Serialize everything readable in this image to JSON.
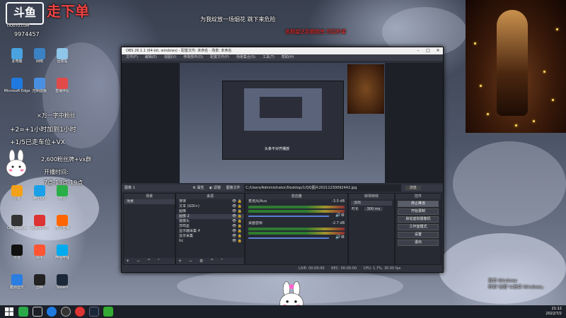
{
  "stream_overlay": {
    "logo_text": "斗鱼",
    "logo_subtext": "DOUYU.COM",
    "channel_title": "走下单",
    "room_number": "9974457",
    "song_line": "为我绽放一场烟花 跳下来危险",
    "comment_line": "逃期望达到拥抱完 然后秒架",
    "promo": {
      "line1": "×万一字中粉丝",
      "line2": "+2=+1小时加到1小时",
      "line3": "+1/5已走车位+VX",
      "line4": "2,600粉丝牌+vx群",
      "schedule_label": "开播时间:",
      "schedule_time": "7点-13点-19点"
    }
  },
  "obs": {
    "window_title": "OBS 26.1.1 (64-bit, windows) - 配置文件: 未命名 - 场景: 未命名",
    "menu": [
      "文件(F)",
      "编辑(E)",
      "视图(V)",
      "停靠部件(D)",
      "配置文件(P)",
      "场景集合(S)",
      "工具(T)",
      "帮助(H)"
    ],
    "context_bar": {
      "scene_label": "图像 1",
      "properties": "属性",
      "filters": "滤镜",
      "image_file_label": "图像文件",
      "image_path": "C:/Users/Administrator/Desktop/1/QQ图片20211230092442.jpg",
      "browse": "浏览"
    },
    "scenes": {
      "header": "场景",
      "items": [
        "场景"
      ]
    },
    "sources": {
      "header": "来源",
      "items": [
        "排排",
        "文本 (GDI+)",
        "图像",
        "图像 2",
        "摄像头",
        "苏鸣星",
        "显示器采集 4",
        "显示采集",
        "tic"
      ]
    },
    "mixer": {
      "header": "混音器",
      "channels": [
        {
          "name": "麦克风/Aux",
          "db": "-3.0 dB"
        },
        {
          "name": "桌面音频",
          "db": "-2.7 dB"
        }
      ]
    },
    "transitions": {
      "header": "转场特效",
      "type": "淡出",
      "duration_label": "时长",
      "duration": "300 ms"
    },
    "controls": {
      "header": "控件",
      "buttons": [
        "停止推流",
        "开始录制",
        "启动虚拟摄像机",
        "工作室模式",
        "设置",
        "退出"
      ]
    },
    "status": {
      "live": "LIVE: 00:00:00",
      "rec": "REC: 00:00:00",
      "cpu": "CPU: 1.7%, 30.00 fps"
    }
  },
  "preview_caption": "头条不对齐播放",
  "desktop_icons": [
    "此电脑",
    "网络",
    "回收站",
    "Microsoft Edge",
    "控制面板",
    "直播伴侣",
    "斗鱼",
    "腾讯QQ",
    "微信",
    "OBS Studio",
    "网易云音乐",
    "虎牙直播",
    "抖音",
    "快手",
    "哔哩哔哩",
    "酷狗音乐",
    "剪映",
    "Steam"
  ],
  "watermark": "激活 Windows\n转到\"设置\"以激活 Windows。",
  "taskbar": {
    "time": "21:12",
    "date": "2022/7/2"
  }
}
